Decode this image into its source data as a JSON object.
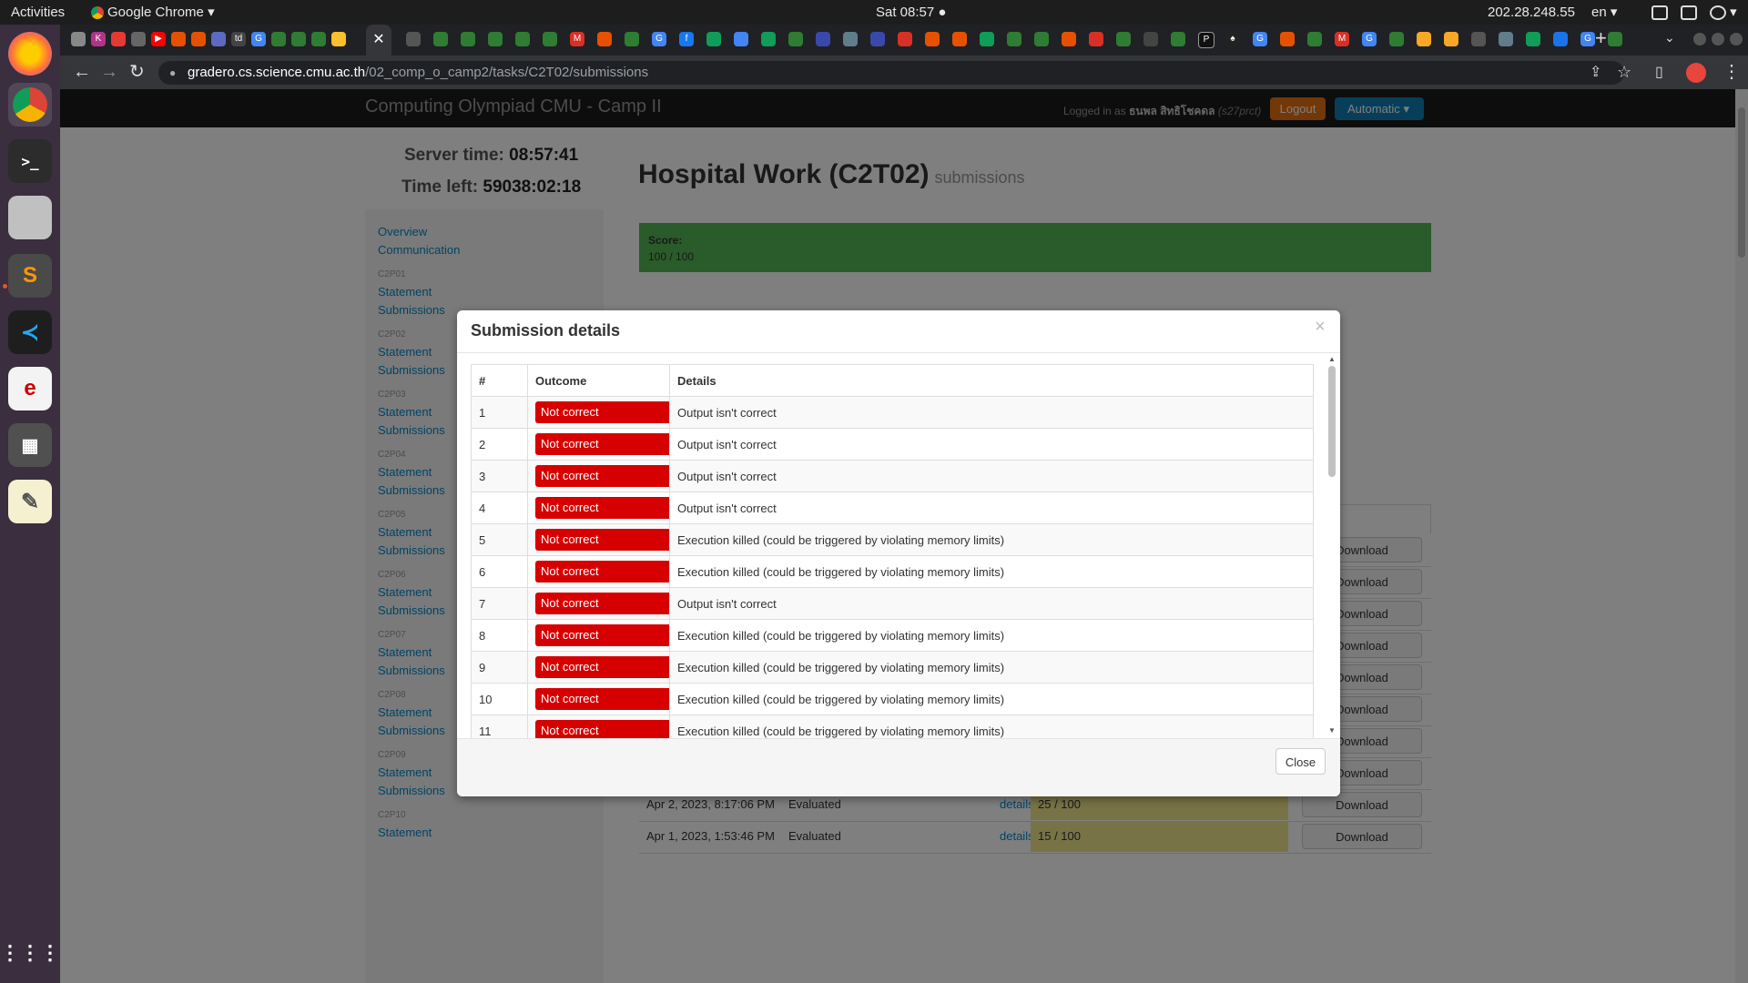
{
  "system_bar": {
    "activities": "Activities",
    "app_name": "Google Chrome",
    "clock": "Sat 08:57 ●",
    "ip": "202.28.248.55",
    "lang": "en"
  },
  "browser": {
    "url_host": "gradero.cs.science.cmu.ac.th",
    "url_path": "/02_comp_o_camp2/tasks/C2T02/submissions",
    "active_tab_icon": "close-icon"
  },
  "page": {
    "brand": "Computing Olympiad CMU - Camp II",
    "logged_in_prefix": "Logged in as",
    "user_name": "ธนพล สิทธิโชคดล",
    "user_id": "(s27prct)",
    "logout": "Logout",
    "language": "Automatic",
    "server_time_label": "Server time:",
    "server_time": "08:57:41",
    "time_left_label": "Time left:",
    "time_left": "59038:02:18",
    "title": "Hospital Work (C2T02)",
    "subtitle": "submissions",
    "score_label": "Score:",
    "score_value": "100 / 100",
    "sidebar": {
      "overview": "Overview",
      "communication": "Communication",
      "tasks": [
        {
          "code": "C2P01",
          "statement": "Statement",
          "submissions": "Submissions"
        },
        {
          "code": "C2P02",
          "statement": "Statement",
          "submissions": "Submissions"
        },
        {
          "code": "C2P03",
          "statement": "Statement",
          "submissions": "Submissions"
        },
        {
          "code": "C2P04",
          "statement": "Statement",
          "submissions": "Submissions"
        },
        {
          "code": "C2P05",
          "statement": "Statement",
          "submissions": "Submissions"
        },
        {
          "code": "C2P06",
          "statement": "Statement",
          "submissions": "Submissions"
        },
        {
          "code": "C2P07",
          "statement": "Statement",
          "submissions": "Submissions"
        },
        {
          "code": "C2P08",
          "statement": "Statement",
          "submissions": "Submissions"
        },
        {
          "code": "C2P09",
          "statement": "Statement",
          "submissions": "Submissions"
        },
        {
          "code": "C2P10",
          "statement": "Statement"
        }
      ]
    },
    "visible_submissions": [
      {
        "time": "Apr 2, 2023, 8:17:06 PM",
        "status": "Evaluated",
        "details": "details",
        "score": "25 / 100",
        "download": "Download"
      },
      {
        "time": "Apr 1, 2023, 1:53:46 PM",
        "status": "Evaluated",
        "details": "details",
        "score": "15 / 100",
        "download": "Download"
      }
    ],
    "download_label": "Download"
  },
  "modal": {
    "title": "Submission details",
    "close_x": "×",
    "columns": [
      "#",
      "Outcome",
      "Details"
    ],
    "rows": [
      {
        "n": "1",
        "outcome": "Not correct",
        "details": "Output isn't correct"
      },
      {
        "n": "2",
        "outcome": "Not correct",
        "details": "Output isn't correct"
      },
      {
        "n": "3",
        "outcome": "Not correct",
        "details": "Output isn't correct"
      },
      {
        "n": "4",
        "outcome": "Not correct",
        "details": "Output isn't correct"
      },
      {
        "n": "5",
        "outcome": "Not correct",
        "details": "Execution killed (could be triggered by violating memory limits)"
      },
      {
        "n": "6",
        "outcome": "Not correct",
        "details": "Execution killed (could be triggered by violating memory limits)"
      },
      {
        "n": "7",
        "outcome": "Not correct",
        "details": "Output isn't correct"
      },
      {
        "n": "8",
        "outcome": "Not correct",
        "details": "Execution killed (could be triggered by violating memory limits)"
      },
      {
        "n": "9",
        "outcome": "Not correct",
        "details": "Execution killed (could be triggered by violating memory limits)"
      },
      {
        "n": "10",
        "outcome": "Not correct",
        "details": "Execution killed (could be triggered by violating memory limits)"
      },
      {
        "n": "11",
        "outcome": "Not correct",
        "details": "Execution killed (could be triggered by violating memory limits)"
      }
    ],
    "close_button": "Close"
  },
  "colors": {
    "not_correct": "#d70000",
    "score_ok": "#54b654",
    "score_partial": "#f0e68c",
    "link": "#0088cc"
  }
}
